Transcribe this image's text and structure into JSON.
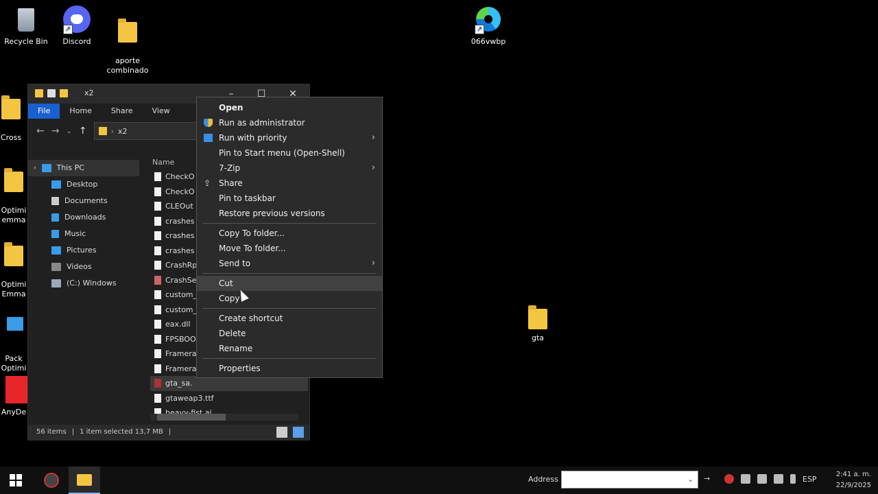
{
  "desktop": {
    "icons": [
      {
        "label": "Recycle Bin"
      },
      {
        "label": "Discord"
      },
      {
        "label": "aporte\ncombinado"
      },
      {
        "label": "066vwbp"
      },
      {
        "label": "gta"
      }
    ],
    "partial_labels": [
      "Cross",
      "Optimi\nemma",
      "Optimi\nEmma",
      "Pack\nOptimi",
      "AnyDe"
    ]
  },
  "explorer": {
    "title": "x2",
    "ribbon": [
      "File",
      "Home",
      "Share",
      "View"
    ],
    "path_label": "x2",
    "nav_items": [
      {
        "label": "This PC",
        "selected": true
      },
      {
        "label": "Desktop"
      },
      {
        "label": "Documents"
      },
      {
        "label": "Downloads"
      },
      {
        "label": "Music"
      },
      {
        "label": "Pictures"
      },
      {
        "label": "Videos"
      },
      {
        "label": "(C:) Windows"
      }
    ],
    "column_header": "Name",
    "files": [
      "CheckO",
      "CheckO",
      "CLEOut",
      "crashes",
      "crashes",
      "crashes",
      "CrashRp",
      "CrashSe",
      "custom_",
      "custom_",
      "eax.dll",
      "FPSBOO",
      "Framera",
      "Framera",
      "gta_sa.",
      "gtaweap3.ttf",
      "heavy-fist.ai"
    ],
    "selected_file_index": 14,
    "status": {
      "count": "56 items",
      "selected": "1 item selected  13,7 MB"
    }
  },
  "context_menu": {
    "items": [
      {
        "type": "item",
        "label": "Open",
        "bold": true
      },
      {
        "type": "item",
        "label": "Run as administrator",
        "icon": "shield-icon"
      },
      {
        "type": "item",
        "label": "Run with priority",
        "icon": "priority-icon",
        "submenu": true
      },
      {
        "type": "item",
        "label": "Pin to Start menu (Open-Shell)"
      },
      {
        "type": "item",
        "label": "7-Zip",
        "submenu": true
      },
      {
        "type": "item",
        "label": "Share",
        "icon": "share-icon"
      },
      {
        "type": "item",
        "label": "Pin to taskbar"
      },
      {
        "type": "item",
        "label": "Restore previous versions"
      },
      {
        "type": "separator"
      },
      {
        "type": "item",
        "label": "Copy To folder..."
      },
      {
        "type": "item",
        "label": "Move To folder..."
      },
      {
        "type": "item",
        "label": "Send to",
        "submenu": true
      },
      {
        "type": "separator"
      },
      {
        "type": "item",
        "label": "Cut",
        "hover": true
      },
      {
        "type": "item",
        "label": "Copy"
      },
      {
        "type": "separator"
      },
      {
        "type": "item",
        "label": "Create shortcut"
      },
      {
        "type": "item",
        "label": "Delete"
      },
      {
        "type": "item",
        "label": "Rename"
      },
      {
        "type": "separator"
      },
      {
        "type": "item",
        "label": "Properties"
      }
    ]
  },
  "taskbar": {
    "address_label": "Address",
    "address_value": "",
    "language": "ESP",
    "time": "2:41 a. m.",
    "date": "22/9/2025"
  }
}
